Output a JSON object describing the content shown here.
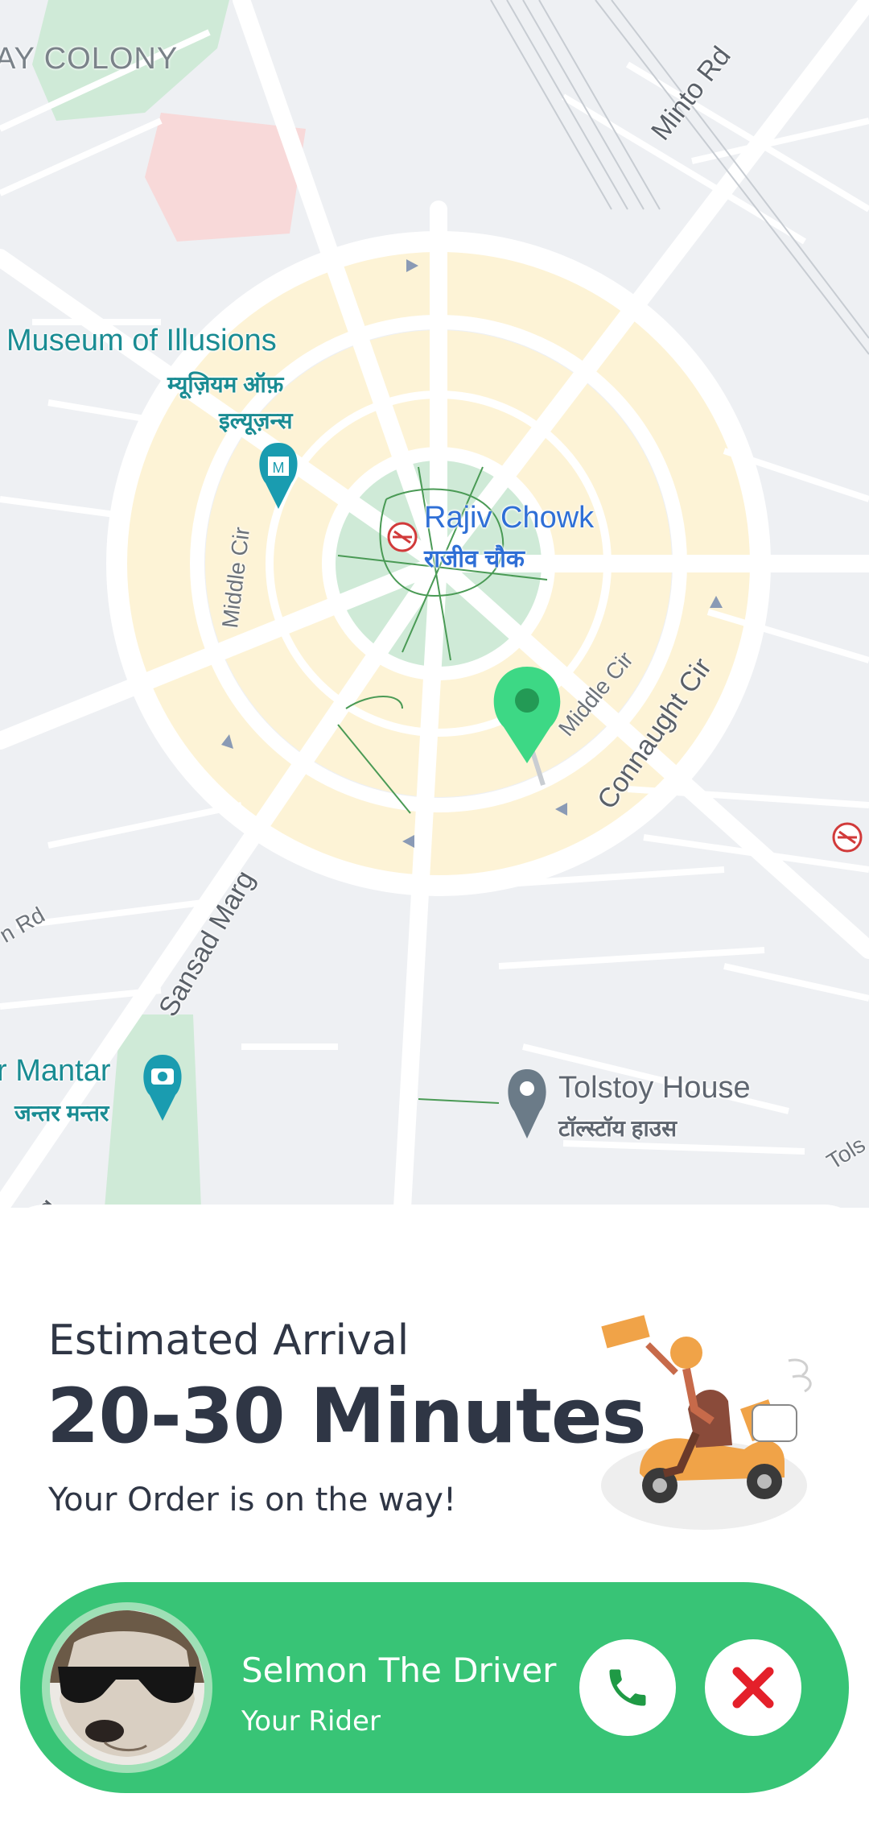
{
  "map": {
    "colony_label": "AY COLONY",
    "poi_museum_en": "Museum of Illusions",
    "poi_museum_hi_1": "म्यूज़ियम ऑफ़",
    "poi_museum_hi_2": "इल्यूज़न्स",
    "poi_station_en": "Rajiv Chowk",
    "poi_station_hi": "राजीव चौक",
    "poi_mantar_en": "r Mantar",
    "poi_mantar_hi": "जन्तर मन्तर",
    "poi_tolstoy_en": "Tolstoy House",
    "poi_tolstoy_hi": "टॉल्स्टॉय हाउस",
    "road_minto": "Minto Rd",
    "road_middle_cir_left": "Middle Cir",
    "road_middle_cir_right": "Middle Cir",
    "road_connaught": "Connaught Cir",
    "road_sansad": "Sansad Marg",
    "road_marg_bottom": "Marg",
    "road_rd_left": "n Rd",
    "road_tols": "Tols",
    "colors": {
      "road": "#ffffff",
      "block": "#fdf3d6",
      "park": "#cfead7",
      "land": "#eef0f3",
      "pin": "#3dd885",
      "poi_teal": "#1a9cb0"
    }
  },
  "eta": {
    "label": "Estimated Arrival",
    "value": "20-30 Minutes",
    "subtitle": "Your Order is on the way!"
  },
  "driver": {
    "name": "Selmon The Driver",
    "role": "Your Rider",
    "card_color": "#38c476"
  },
  "actions": {
    "call_icon": "phone-icon",
    "cancel_icon": "close-icon",
    "call_color": "#1f9a45",
    "cancel_color": "#e4202a"
  }
}
